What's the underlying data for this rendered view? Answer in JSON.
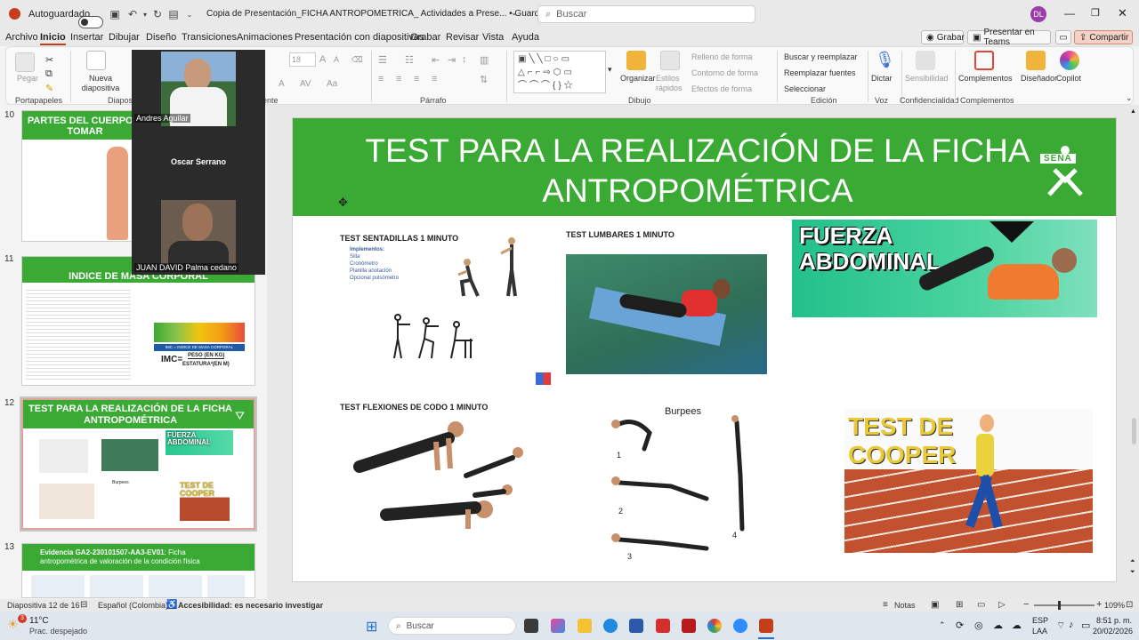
{
  "titlebar": {
    "autosave": "Autoguardado",
    "doc_title": "Copia de Presentación_FICHA ANTROPOMETRICA_ Actividades a Prese... • Guardado en Este PC",
    "search_placeholder": "Buscar",
    "user_initials": "DL"
  },
  "menu": {
    "items": [
      "Archivo",
      "Inicio",
      "Insertar",
      "Dibujar",
      "Diseño",
      "Transiciones",
      "Animaciones",
      "Presentación con diapositivas",
      "Grabar",
      "Revisar",
      "Vista",
      "Ayuda"
    ],
    "record": "Grabar",
    "present_teams": "Presentar en Teams",
    "share": "Compartir"
  },
  "ribbon": {
    "paste": "Pegar",
    "clipboard": "Portapapeles",
    "new_slide": "Nueva diapositiva",
    "slides_group": "Diapositivas",
    "font_size": "18",
    "paragraph": "Párrafo",
    "drawing": "Dibujo",
    "organize": "Organizar",
    "quick_styles": "Estilos rápidos",
    "shape_fill": "Relleno de forma",
    "shape_outline": "Contorno de forma",
    "shape_effects": "Efectos de forma",
    "find_replace": "Buscar y reemplazar",
    "replace_fonts": "Reemplazar fuentes",
    "select": "Seleccionar",
    "editing": "Edición",
    "dictate": "Dictar",
    "voice": "Voz",
    "sensitivity": "Sensibilidad",
    "confidentiality": "Confidencialidad",
    "addins": "Complementos",
    "addins_group": "Complementos",
    "designer": "Diseñador",
    "copilot": "Copilot",
    "fuente": "ente"
  },
  "thumbs": [
    {
      "num": "10",
      "title": "PARTES DEL CUERPO A TOMAR"
    },
    {
      "num": "11",
      "title": "INDICE DE MASA CORPORAL",
      "imc_box": "IMC = INDICE DE MASA CORPORAL",
      "imc_formula": "IMC=",
      "imc_top": "PESO (EN KG)",
      "imc_bottom": "ESTATURA²(EN M)"
    },
    {
      "num": "12",
      "title": "TEST PARA LA REALIZACIÓN DE LA FICHA ANTROPOMÉTRICA",
      "mini_fuerza": "FUERZA ABDOMINAL",
      "mini_cooper": "TEST DE COOPER",
      "mini_burpees": "Burpees"
    },
    {
      "num": "13",
      "title_bold": "Evidencia GA2-230101507-AA3-EV01",
      "title_rest": ": Ficha antropométrica de valoración de la condición física"
    }
  ],
  "participants": [
    {
      "name": "Andres  Aguilar"
    },
    {
      "name": "Oscar Serrano"
    },
    {
      "name": "JUAN DAVID Palma cedano"
    }
  ],
  "slide": {
    "title": "TEST PARA LA REALIZACIÓN DE LA FICHA ANTROPOMÉTRICA",
    "logo_text": "SENA",
    "t1": "TEST SENTADILLAS 1 MINUTO",
    "t1_head": "Implementos:",
    "t1_items": [
      "Silla",
      "Cronómetro",
      "Planilla anotación",
      "Opcional pulsómetro"
    ],
    "t2": "TEST LUMBARES 1 MINUTO",
    "t3_line1": "FUERZA",
    "t3_line2": "ABDOMINAL",
    "t4": "TEST FLEXIONES DE CODO 1 MINUTO",
    "t5": "Burpees",
    "t5_steps": [
      "1",
      "2",
      "3",
      "4"
    ],
    "t6_line1": "TEST DE",
    "t6_line2": "COOPER"
  },
  "status": {
    "slide_counter": "Diapositiva 12 de 16",
    "language": "Español (Colombia)",
    "accessibility": "Accesibilidad: es necesario investigar",
    "notes": "Notas",
    "zoom": "109%"
  },
  "taskbar": {
    "temp": "11°C",
    "weather": "Prac. despejado",
    "weather_badge": "3",
    "search": "Buscar",
    "lang1": "ESP",
    "lang2": "LAA",
    "time": "8:51 p. m.",
    "date": "20/02/2026"
  },
  "colors": {
    "accent": "#c43e1c",
    "green": "#3aaa35"
  }
}
